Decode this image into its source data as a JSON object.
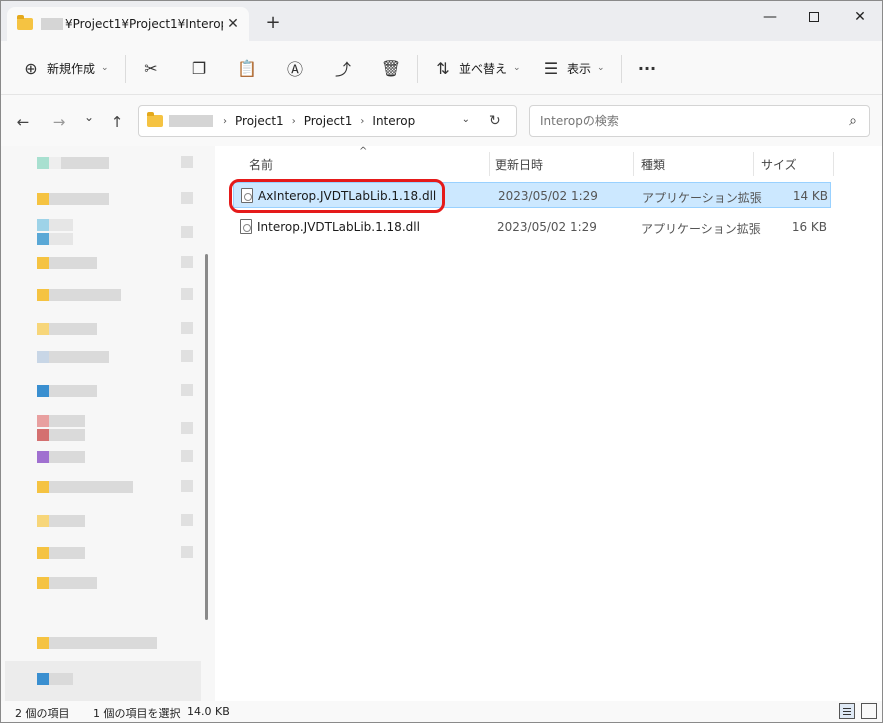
{
  "window": {
    "tab_title": "¥Project1¥Project1¥Interop",
    "tab_close": "✕",
    "new_tab": "+",
    "minimize": "—",
    "close": "✕"
  },
  "toolbar": {
    "new_label": "新規作成",
    "sort_label": "並べ替え",
    "view_label": "表示",
    "more": "···"
  },
  "nav": {
    "back": "←",
    "forward": "→",
    "recent": "⌄",
    "up": "↑",
    "breadcrumbs": [
      "Project1",
      "Project1",
      "Interop"
    ],
    "crumb_sep": "›",
    "refresh": "↻",
    "addr_caret": "⌄"
  },
  "search": {
    "placeholder": "Interopの検索",
    "icon": "⌕"
  },
  "columns": {
    "sort_indicator": "^",
    "name": "名前",
    "date": "更新日時",
    "type": "種類",
    "size": "サイズ"
  },
  "files": [
    {
      "name": "AxInterop.JVDTLabLib.1.18.dll",
      "date": "2023/05/02 1:29",
      "type": "アプリケーション拡張",
      "size": "14 KB",
      "selected": true
    },
    {
      "name": "Interop.JVDTLabLib.1.18.dll",
      "date": "2023/05/02 1:29",
      "type": "アプリケーション拡張",
      "size": "16 KB",
      "selected": false
    }
  ],
  "status": {
    "item_count": "2 個の項目",
    "selection": "1 個の項目を選択",
    "selection_size": "14.0 KB"
  },
  "colors": {
    "selection_bg": "#cce8ff",
    "highlight_ring": "#e51a1a",
    "folder": "#f5c342"
  }
}
